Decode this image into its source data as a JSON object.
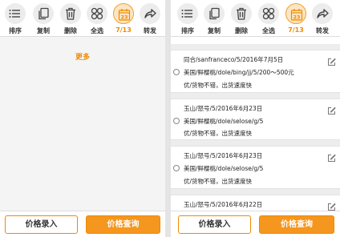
{
  "toolbar": {
    "items": [
      {
        "label": "排序",
        "icon": "sort-list-icon"
      },
      {
        "label": "复制",
        "icon": "copy-icon"
      },
      {
        "label": "删除",
        "icon": "trash-icon"
      },
      {
        "label": "全选",
        "icon": "select-all-icon"
      },
      {
        "label": "7/13",
        "icon": "calendar-icon",
        "badge": "23",
        "active": true
      },
      {
        "label": "转发",
        "icon": "forward-icon"
      }
    ]
  },
  "left": {
    "more_label": "更多"
  },
  "right": {
    "records": [
      {
        "line1": "同合/sanfranceco/5/2016年7月5日",
        "line2": "美国/鲜樱桃/dole/bing/jj/5/200～500元",
        "line3": "优/货物不错，出货速度快"
      },
      {
        "line1": "玉山/怒号/5/2016年6月23日",
        "line2": "美国/鲜樱桃/dole/selose/g/5",
        "line3": "优/货物不错，出货速度快"
      },
      {
        "line1": "玉山/怒号/5/2016年6月23日",
        "line2": "美国/鲜樱桃/dole/selose/g/5",
        "line3": "优/货物不错，出货速度快"
      },
      {
        "line1": "玉山/怒号/5/2016年6月22日",
        "line2": "",
        "line3": ""
      }
    ]
  },
  "bottom": {
    "price_entry_label": "价格录入",
    "price_query_label": "价格查询"
  },
  "colors": {
    "accent": "#f08a00",
    "button_fill": "#f5961f",
    "icon_bg": "#ececec"
  }
}
